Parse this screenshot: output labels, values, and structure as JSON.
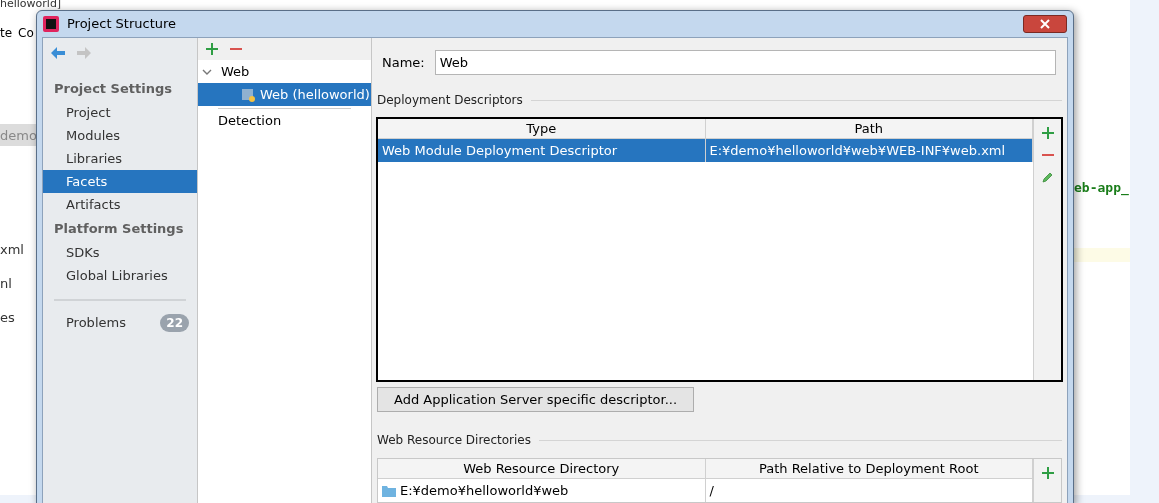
{
  "ide": {
    "title_fragment": "helloworld]",
    "menu_fragments": [
      "te",
      "Co"
    ],
    "left_fragments": [
      "demo",
      "xml",
      "nl",
      "es"
    ],
    "code_fragment": "eb-app_"
  },
  "dialog": {
    "title": "Project Structure"
  },
  "sidebar": {
    "sections": [
      {
        "title": "Project Settings",
        "items": [
          {
            "label": "Project",
            "selected": false
          },
          {
            "label": "Modules",
            "selected": false
          },
          {
            "label": "Libraries",
            "selected": false
          },
          {
            "label": "Facets",
            "selected": true
          },
          {
            "label": "Artifacts",
            "selected": false
          }
        ]
      },
      {
        "title": "Platform Settings",
        "items": [
          {
            "label": "SDKs",
            "selected": false
          },
          {
            "label": "Global Libraries",
            "selected": false
          }
        ]
      }
    ],
    "problems": {
      "label": "Problems",
      "count": "22"
    }
  },
  "facet_tree": {
    "items": [
      {
        "label": "Web",
        "expanded": true,
        "selected": false,
        "children": [
          {
            "label": "Web (helloworld)",
            "selected": true
          }
        ]
      }
    ],
    "detection": "Detection"
  },
  "name_field": {
    "label": "Name:",
    "value": "Web"
  },
  "deployment": {
    "title": "Deployment Descriptors",
    "highlighted": true,
    "columns": [
      "Type",
      "Path"
    ],
    "rows": [
      {
        "cells": [
          "Web Module Deployment Descriptor",
          "E:¥demo¥helloworld¥web¥WEB-INF¥web.xml"
        ],
        "selected": true
      }
    ]
  },
  "add_button": "Add Application Server specific descriptor...",
  "resources": {
    "title": "Web Resource Directories",
    "columns": [
      "Web Resource Directory",
      "Path Relative to Deployment Root"
    ],
    "rows": [
      {
        "cells": [
          "E:¥demo¥helloworld¥web",
          "/"
        ],
        "selected": false
      }
    ]
  }
}
